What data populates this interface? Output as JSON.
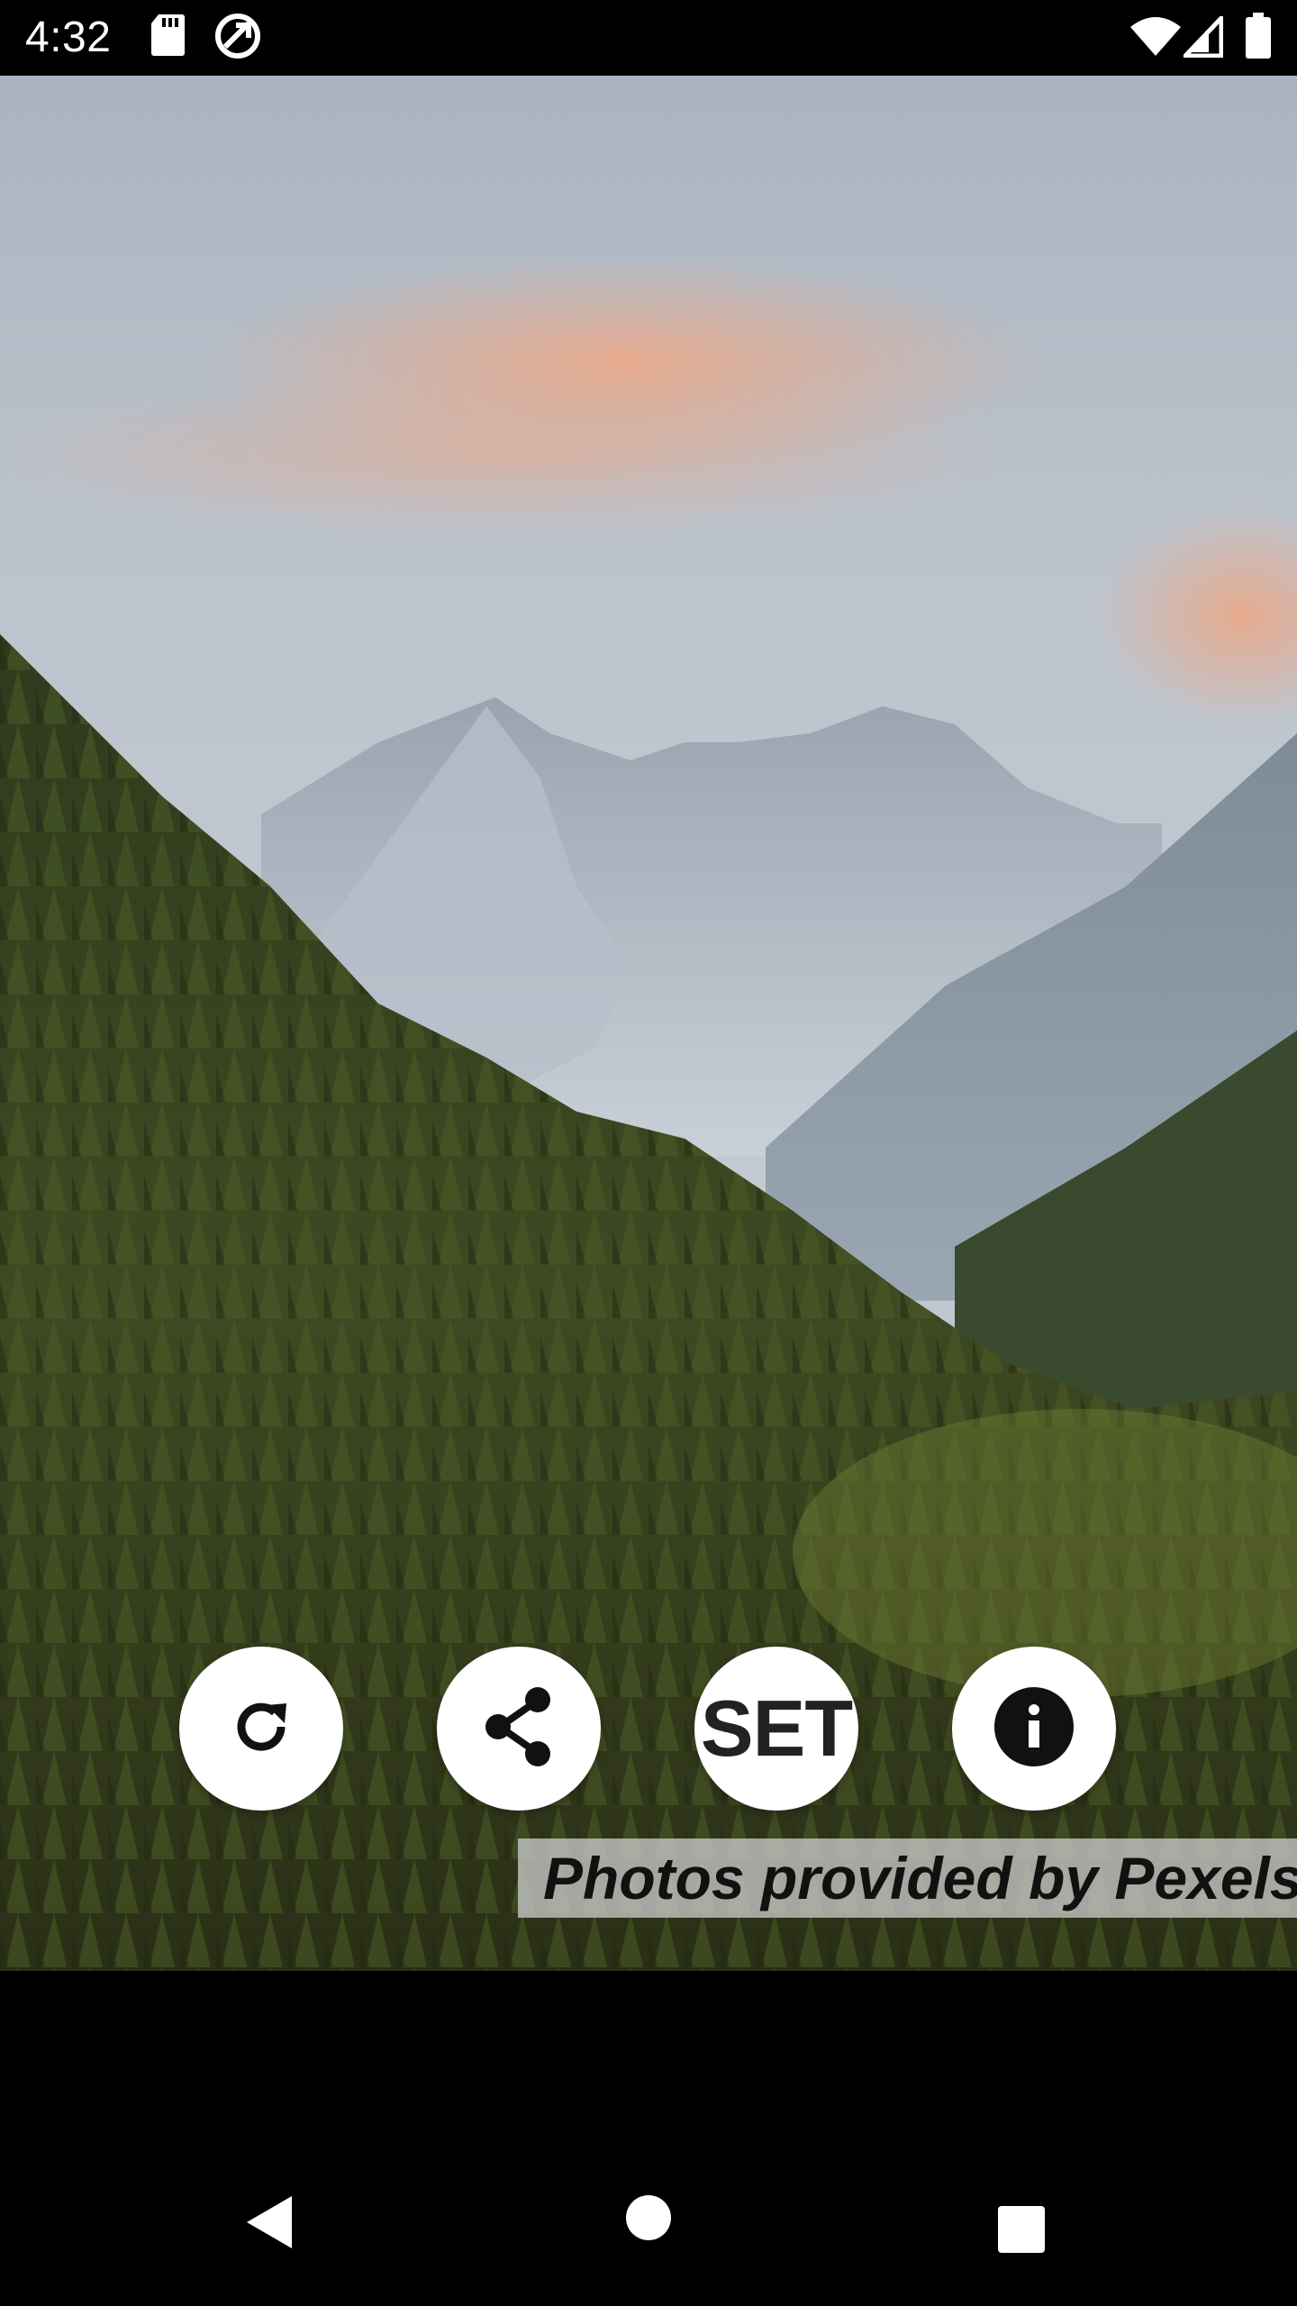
{
  "status_bar": {
    "time": "4:32",
    "left_icons": [
      "sd-card-icon",
      "data-saver-icon"
    ],
    "right_icons": [
      "wifi-icon",
      "cellular-signal-icon",
      "battery-icon"
    ]
  },
  "wallpaper": {
    "description_icon": "mountain-forest-photo"
  },
  "actions": {
    "refresh_icon": "refresh-icon",
    "share_icon": "share-icon",
    "set_label": "SET",
    "info_icon": "info-icon"
  },
  "credit": {
    "text": "Photos provided by Pexels"
  },
  "nav": {
    "icons": [
      "back-icon",
      "home-icon",
      "recents-icon"
    ]
  },
  "colors": {
    "button_bg": "#ffffff",
    "icon_color": "#111111",
    "credit_bg": "#c8c8c8"
  }
}
